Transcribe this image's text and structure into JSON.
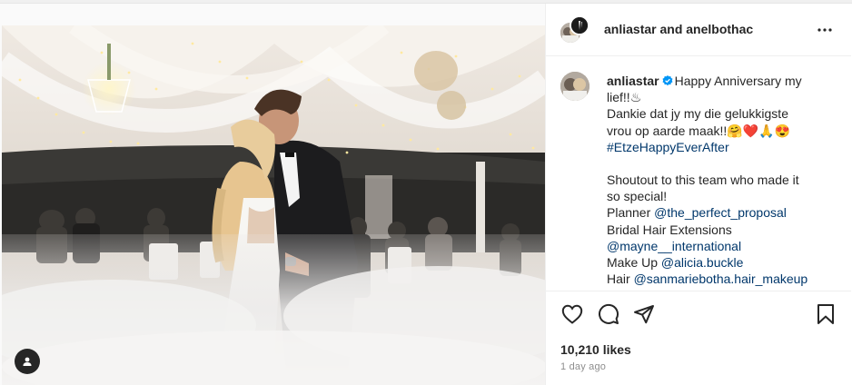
{
  "header": {
    "title": "anliastar and anelbothac"
  },
  "caption": {
    "username": "anliastar",
    "line1": "Happy Anniversary my",
    "line2": "lief!!",
    "line2_emoji": "♨",
    "line3": "Dankie dat jy my die gelukkigste",
    "line4": "vrou op aarde maak!!",
    "line4_emoji": "🤗❤️🙏😍",
    "hashtag": "#EtzeHappyEverAfter",
    "line5": "Shoutout to this team who made it",
    "line6": "so special!",
    "planner_label": "Planner",
    "planner_mention": "@the_perfect_proposal",
    "hair_ext_label": "Bridal Hair Extensions",
    "hair_ext_mention": "@mayne__international",
    "makeup_label": "Make Up",
    "makeup_mention": "@alicia.buckle",
    "hair_label": "Hair",
    "hair_mention": "@sanmariebotha.hair_makeup"
  },
  "stats": {
    "likes": "10,210 likes",
    "posted": "1 day ago"
  },
  "icons": {
    "like": "heart-icon",
    "comment": "comment-icon",
    "share": "paper-plane-icon",
    "save": "bookmark-icon",
    "more": "more-horizontal-icon",
    "tag": "user-tag-icon",
    "verified": "verified-badge-icon"
  },
  "colors": {
    "link": "#00376b",
    "verified": "#0095f6",
    "muted": "#8e8e8e",
    "text": "#262626"
  }
}
